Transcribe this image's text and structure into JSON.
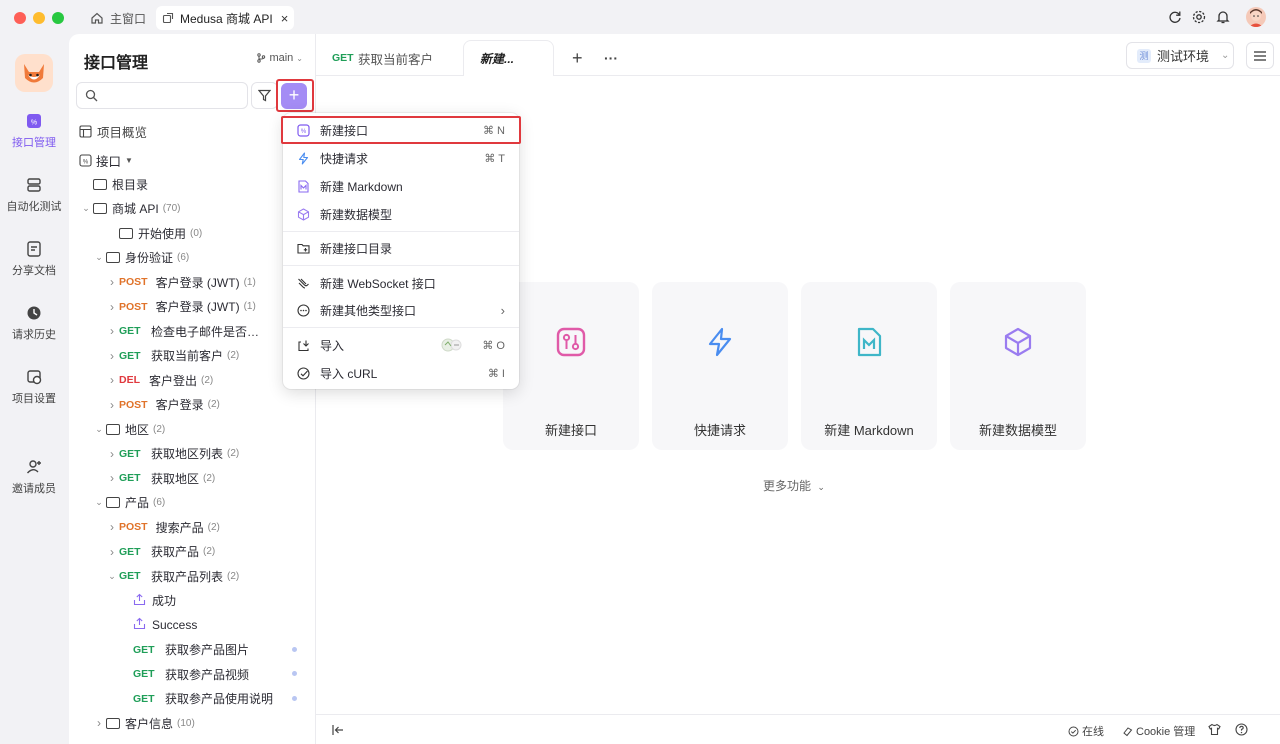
{
  "window": {
    "home_tab": "主窗口",
    "app_tab": "Medusa 商城 API",
    "close": "×"
  },
  "leftnav": {
    "items": [
      "接口管理",
      "自动化测试",
      "分享文档",
      "请求历史",
      "项目设置",
      "邀请成员"
    ]
  },
  "sidebar": {
    "title": "接口管理",
    "branch": "main",
    "search_placeholder": "",
    "plus": "+",
    "overview": "项目概览",
    "api_root": "接口",
    "tree": [
      {
        "type": "folder",
        "label": "根目录",
        "count": ""
      },
      {
        "type": "folder",
        "label": "商城 API",
        "count": "(70)"
      },
      {
        "type": "folder",
        "label": "开始使用",
        "count": "(0)"
      },
      {
        "type": "folder",
        "label": "身份验证",
        "count": "(6)"
      },
      {
        "type": "api",
        "method": "POST",
        "label": "客户登录 (JWT)",
        "count": "(1)"
      },
      {
        "type": "api",
        "method": "POST",
        "label": "客户登录 (JWT)",
        "count": "(1)"
      },
      {
        "type": "api",
        "method": "GET",
        "label": "检查电子邮件是否…",
        "count": ""
      },
      {
        "type": "api",
        "method": "GET",
        "label": "获取当前客户",
        "count": "(2)"
      },
      {
        "type": "api",
        "method": "DEL",
        "label": "客户登出",
        "count": "(2)"
      },
      {
        "type": "api",
        "method": "POST",
        "label": "客户登录",
        "count": "(2)"
      },
      {
        "type": "folder",
        "label": "地区",
        "count": "(2)"
      },
      {
        "type": "api",
        "method": "GET",
        "label": "获取地区列表",
        "count": "(2)"
      },
      {
        "type": "api",
        "method": "GET",
        "label": "获取地区",
        "count": "(2)"
      },
      {
        "type": "folder",
        "label": "产品",
        "count": "(6)"
      },
      {
        "type": "api",
        "method": "POST",
        "label": "搜索产品",
        "count": "(2)"
      },
      {
        "type": "api",
        "method": "GET",
        "label": "获取产品",
        "count": "(2)"
      },
      {
        "type": "api",
        "method": "GET",
        "label": "获取产品列表",
        "count": "(2)"
      },
      {
        "type": "case",
        "label": "成功"
      },
      {
        "type": "case",
        "label": "Success"
      },
      {
        "type": "api",
        "method": "GET",
        "label": "获取参产品图片",
        "count": ""
      },
      {
        "type": "api",
        "method": "GET",
        "label": "获取参产品视频",
        "count": ""
      },
      {
        "type": "api",
        "method": "GET",
        "label": "获取参产品使用说明",
        "count": ""
      },
      {
        "type": "folder",
        "label": "客户信息",
        "count": "(10)"
      }
    ]
  },
  "tabs": {
    "tab1_method": "GET",
    "tab1_label": "获取当前客户",
    "tab2_label": "新建...",
    "add": "+",
    "more": "···"
  },
  "env": {
    "icon_text": "测",
    "label": "测试环境"
  },
  "cards": [
    "新建接口",
    "快捷请求",
    "新建 Markdown",
    "新建数据模型"
  ],
  "more_features": "更多功能",
  "dropdown": {
    "items": [
      {
        "label": "新建接口",
        "shortcut": "⌘ N",
        "icon": "api-icon"
      },
      {
        "label": "快捷请求",
        "shortcut": "⌘ T",
        "icon": "bolt-icon"
      },
      {
        "label": "新建 Markdown",
        "shortcut": "",
        "icon": "markdown-icon"
      },
      {
        "label": "新建数据模型",
        "shortcut": "",
        "icon": "cube-icon"
      },
      {
        "label": "新建接口目录",
        "shortcut": "",
        "icon": "folder-add-icon"
      },
      {
        "label": "新建 WebSocket 接口",
        "shortcut": "",
        "icon": "websocket-icon"
      },
      {
        "label": "新建其他类型接口",
        "shortcut": "",
        "icon": "more-circle-icon"
      },
      {
        "label": "导入",
        "shortcut": "⌘ O",
        "icon": "import-icon"
      },
      {
        "label": "导入 cURL",
        "shortcut": "⌘ I",
        "icon": "curl-icon"
      }
    ]
  },
  "bottom": {
    "online": "在线",
    "cookie": "Cookie 管理"
  },
  "colors": {
    "accent": "#7f5af0",
    "get": "#1f9e58",
    "post": "#e0732a",
    "del": "#e0393e",
    "highlight": "#e0393e"
  }
}
